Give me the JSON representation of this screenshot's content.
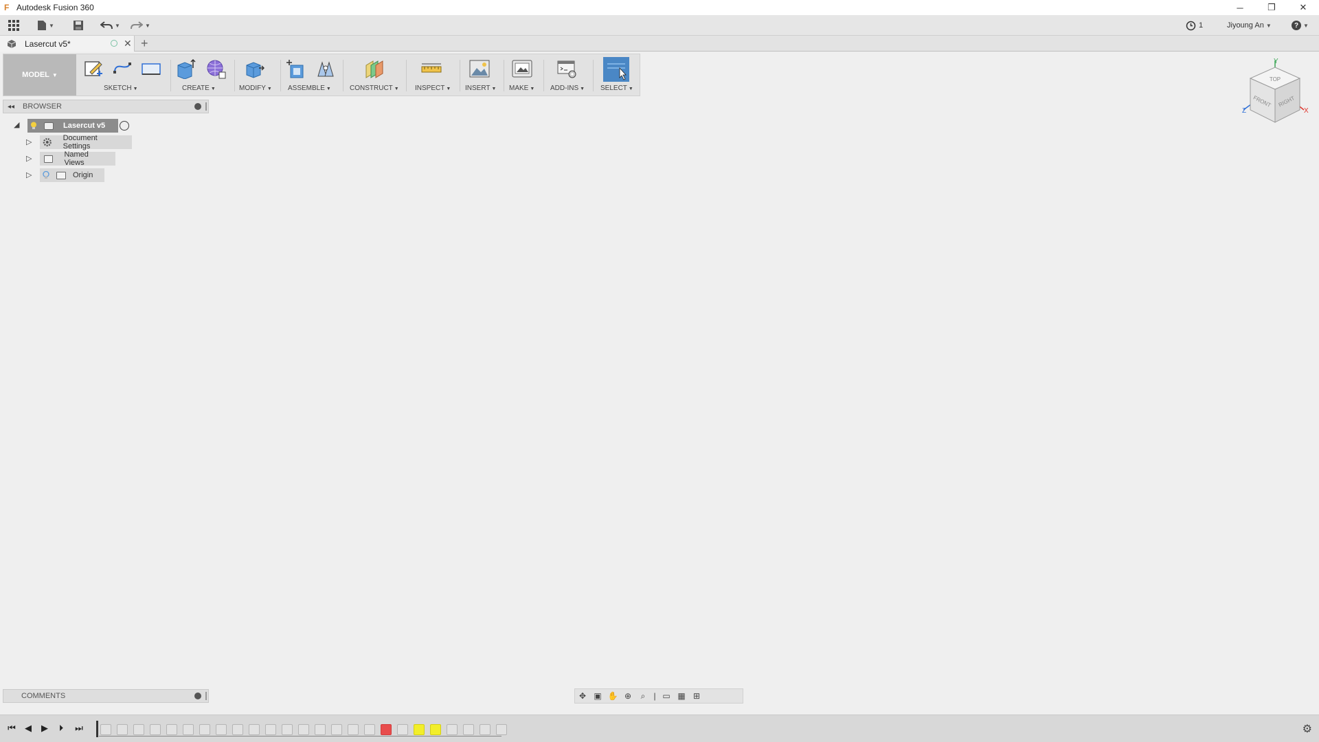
{
  "window": {
    "title": "Autodesk Fusion 360",
    "app_logo": "F",
    "controls": {
      "minimize": "─",
      "restore": "❐",
      "close": "✕"
    }
  },
  "quick_access": {
    "job_status_count": "1",
    "user_name": "Jiyoung An",
    "help_label": "?"
  },
  "document_tab": {
    "label": "Lasercut v5*",
    "close": "✕",
    "new_tab": "+"
  },
  "toolbar": {
    "workspace": "MODEL",
    "groups": {
      "sketch": "SKETCH",
      "create": "CREATE",
      "modify": "MODIFY",
      "assemble": "ASSEMBLE",
      "construct": "CONSTRUCT",
      "inspect": "INSPECT",
      "insert": "INSERT",
      "make": "MAKE",
      "addins": "ADD-INS",
      "select": "SELECT"
    },
    "caret": "▼"
  },
  "browser": {
    "title": "BROWSER",
    "collapse": "◂◂",
    "root": "Lasercut v5",
    "items": [
      {
        "label": "Document Settings",
        "icon": "gear-icon"
      },
      {
        "label": "Named Views",
        "icon": "folder-icon"
      },
      {
        "label": "Origin",
        "icon": "folder-icon"
      }
    ]
  },
  "viewcube": {
    "top": "TOP",
    "front": "FRONT",
    "right": "RIGHT",
    "axis_x": "X",
    "axis_y": "Y",
    "axis_z": "Z",
    "colors": {
      "x": "#e0342b",
      "y": "#3aa655",
      "z": "#2f6fd6"
    }
  },
  "comments": {
    "title": "COMMENTS"
  },
  "timeline": {
    "controls": {
      "first": "⏮",
      "prev": "◀",
      "play": "▶",
      "next": "▶",
      "last": "⏭"
    },
    "settings": "⚙"
  },
  "colors": {
    "accent_blue": "#3b8fd9",
    "select_active": "#4a87c5",
    "timeline_red": "#e84c4c",
    "timeline_yellow": "#f2ee2a"
  }
}
